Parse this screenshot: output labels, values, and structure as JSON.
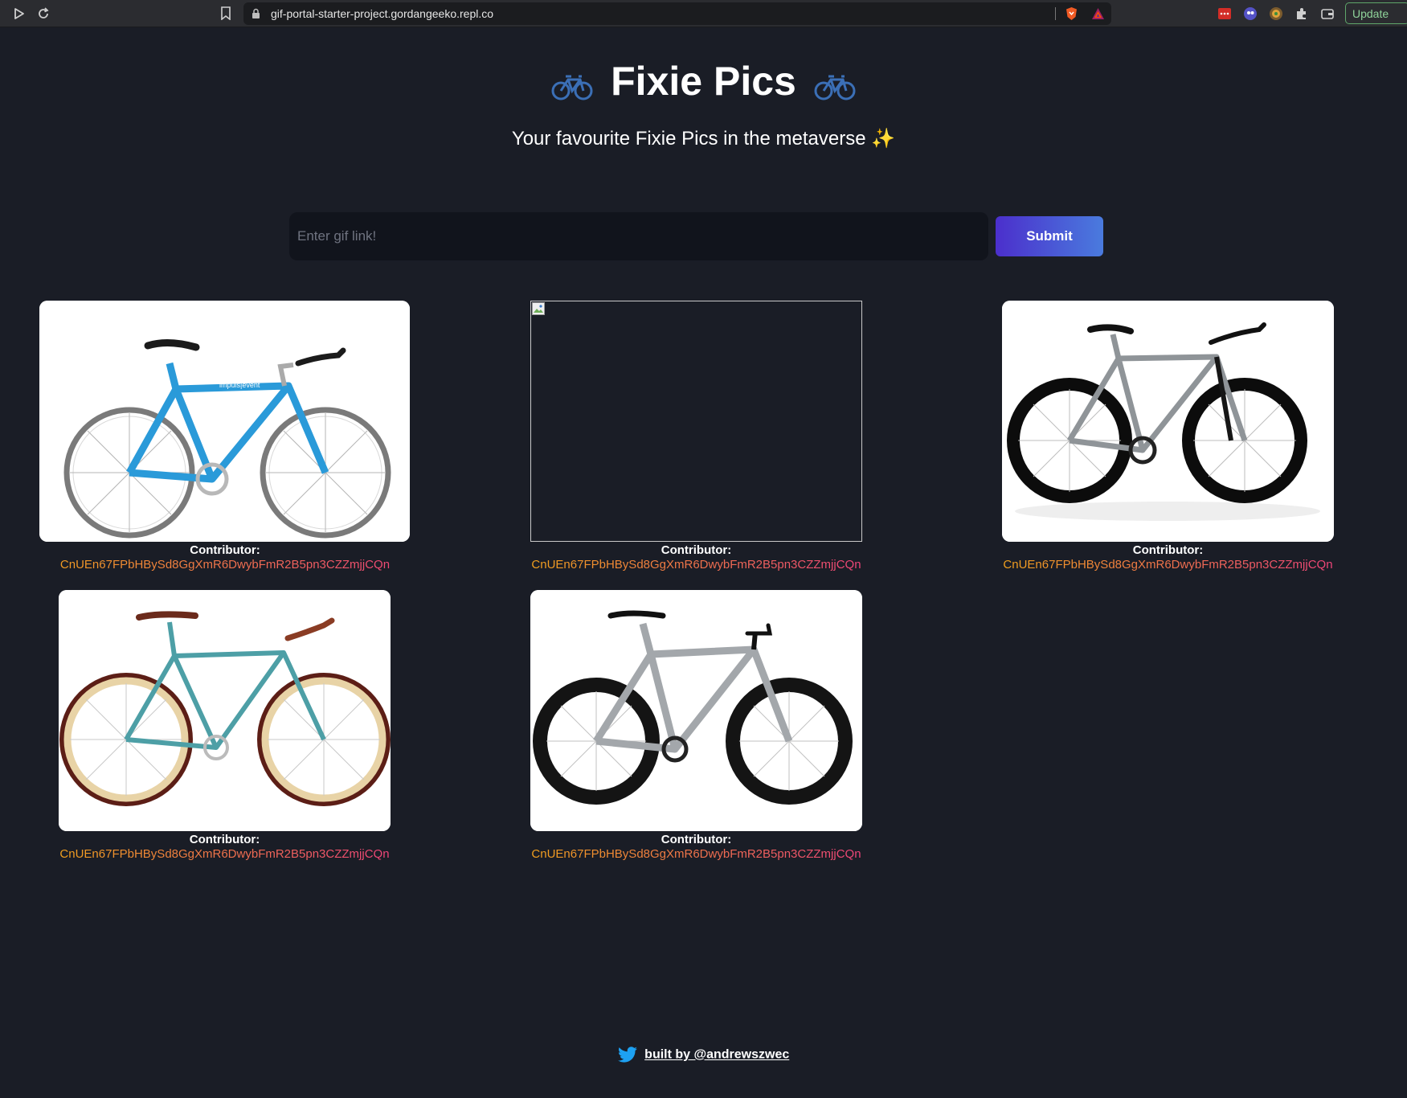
{
  "browser": {
    "url": "gif-portal-starter-project.gordangeeko.repl.co",
    "update_label": "Update"
  },
  "header": {
    "title": "Fixie Pics",
    "subtitle": "Your favourite Fixie Pics in the metaverse",
    "subtitle_emoji": "✨"
  },
  "form": {
    "placeholder": "Enter gif link!",
    "value": "",
    "submit_label": "Submit"
  },
  "gifs": [
    {
      "image": "blue-fixie-bike",
      "contributor_label": "Contributor:",
      "address": "CnUEn67FPbHBySd8GgXmR6DwybFmR2B5pn3CZZmjjCQn"
    },
    {
      "image": "broken-image",
      "contributor_label": "Contributor:",
      "address": "CnUEn67FPbHBySd8GgXmR6DwybFmR2B5pn3CZZmjjCQn"
    },
    {
      "image": "chrome-fixie-bike",
      "contributor_label": "Contributor:",
      "address": "CnUEn67FPbHBySd8GgXmR6DwybFmR2B5pn3CZZmjjCQn"
    },
    {
      "image": "teal-vintage-fixie-bike",
      "contributor_label": "Contributor:",
      "address": "CnUEn67FPbHBySd8GgXmR6DwybFmR2B5pn3CZZmjjCQn"
    },
    {
      "image": "silver-fixie-bike",
      "contributor_label": "Contributor:",
      "address": "CnUEn67FPbHBySd8GgXmR6DwybFmR2B5pn3CZZmjjCQn"
    }
  ],
  "footer": {
    "link_text": "built by @andrewszwec"
  },
  "colors": {
    "background": "#1a1d26",
    "accent_gradient_start": "#f3a21d",
    "accent_gradient_end": "#f0447a",
    "submit_gradient_start": "#4b2fcc",
    "submit_gradient_end": "#4a7bde",
    "twitter_blue": "#1da1f2"
  }
}
